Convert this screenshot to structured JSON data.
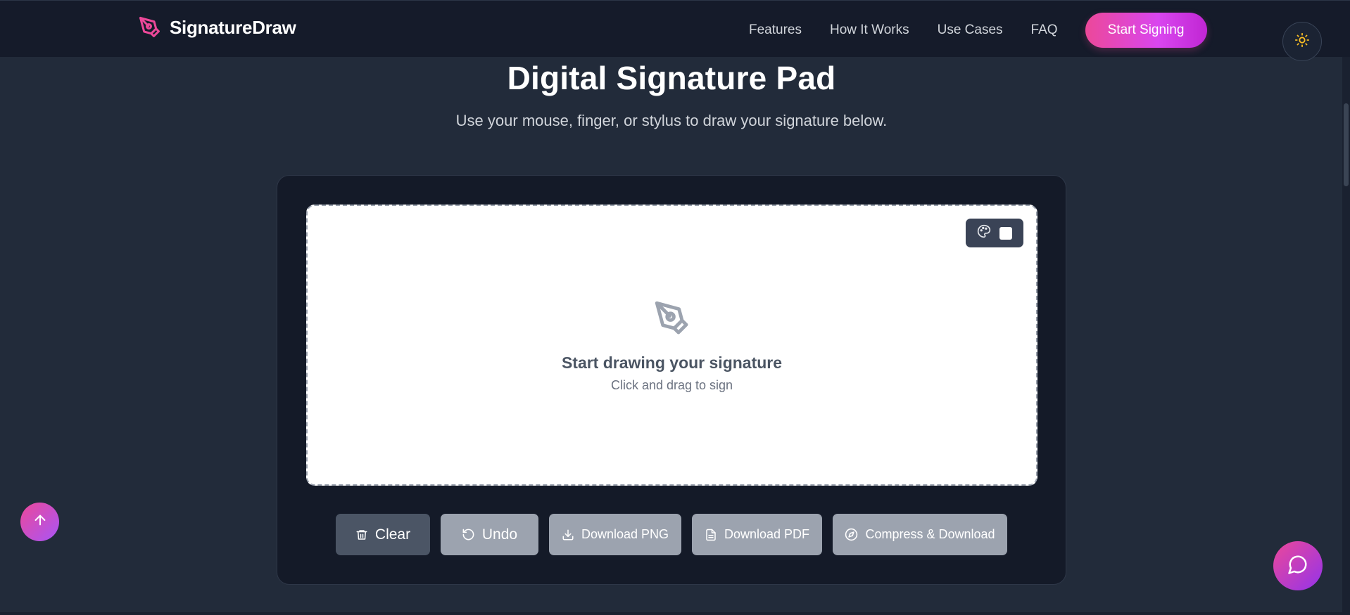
{
  "header": {
    "brand_name": "SignatureDraw",
    "brand_icon": "pen-nib-icon",
    "nav": [
      {
        "label": "Features"
      },
      {
        "label": "How It Works"
      },
      {
        "label": "Use Cases"
      },
      {
        "label": "FAQ"
      }
    ],
    "cta_label": "Start Signing",
    "theme_icon": "sun-icon"
  },
  "hero": {
    "title": "Digital Signature Pad",
    "subtitle": "Use your mouse, finger, or stylus to draw your signature below."
  },
  "pad": {
    "tools_icon": "palette-icon",
    "pen_color": "#ffffff",
    "placeholder_icon": "pen-nib-icon",
    "placeholder_title": "Start drawing your signature",
    "placeholder_hint": "Click and drag to sign"
  },
  "actions": {
    "clear_label": "Clear",
    "undo_label": "Undo",
    "download_png_label": "Download PNG",
    "download_pdf_label": "Download PDF",
    "compress_label": "Compress & Download"
  },
  "floating": {
    "back_to_top_icon": "arrow-up-icon",
    "chat_icon": "chat-bubble-icon"
  },
  "colors": {
    "accent": "#ec4899",
    "accent_secondary": "#a855f7",
    "background": "#222b3a",
    "header_bg": "#151b2a",
    "card_bg": "#141a28"
  }
}
